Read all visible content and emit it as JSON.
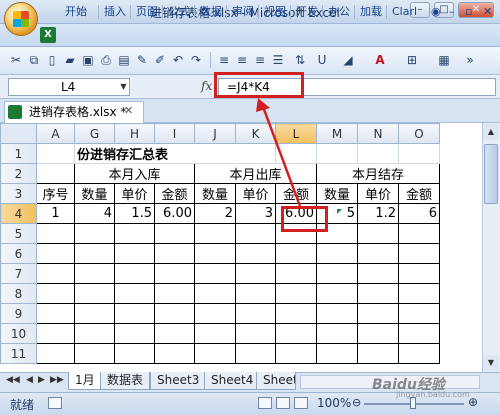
{
  "window": {
    "title": "进销存表格.xlsx - Microsoft Excel",
    "controls": [
      "–",
      "□",
      "✕"
    ]
  },
  "ribbon": {
    "tabs": [
      "开始",
      "插入",
      "页面",
      "公式",
      "数据",
      "审阅",
      "视图",
      "开发",
      "办公",
      "加载",
      "Clarl"
    ]
  },
  "toolbar": {
    "icons": [
      "cut-icon",
      "copy-icon",
      "new-icon",
      "open-icon",
      "save-icon",
      "print-icon",
      "paste-icon",
      "format-painter-icon",
      "undo-icon",
      "redo-icon",
      "align-left-icon",
      "align-center-icon",
      "align-right-icon",
      "underline-icon",
      "fill-color-icon",
      "font-color-icon",
      "borders-icon",
      "more-icon"
    ]
  },
  "formula_bar": {
    "cell_ref": "L4",
    "fx": "fx",
    "formula": "=J4*K4"
  },
  "workbook_tab": {
    "name": "进销存表格.xlsx *",
    "close": "✕"
  },
  "grid": {
    "columns": [
      "A",
      "G",
      "H",
      "I",
      "J",
      "K",
      "L",
      "M",
      "N",
      "O"
    ],
    "selected_column": "L",
    "rows": [
      "1",
      "2",
      "3",
      "4",
      "5",
      "6",
      "7",
      "8",
      "9",
      "10",
      "11"
    ],
    "selected_row": "4",
    "title": "份进销存汇总表",
    "group_in": "本月入库",
    "group_out": "本月出库",
    "group_stock": "本月结存",
    "h_seq": "序号",
    "h_qty": "数量",
    "h_price": "单价",
    "h_amt": "金额",
    "r4": {
      "A": "1",
      "G": "4",
      "H": "1.5",
      "I": "6.00",
      "J": "2",
      "K": "3",
      "L": "6.00",
      "M": "5",
      "N": "1.2",
      "O": "6"
    }
  },
  "sheets": {
    "tabs": [
      "1月",
      "数据表",
      "Sheet3",
      "Sheet4",
      "Sheet"
    ],
    "active": "1月",
    "nav": [
      "◀◀",
      "◀",
      "▶",
      "▶▶"
    ]
  },
  "status": {
    "mode": "就绪",
    "zoom": "100%",
    "minus": "⊖",
    "plus": "⊕"
  },
  "watermark": {
    "text": "Baidu经验",
    "sub": "jingyan.baidu.com"
  }
}
